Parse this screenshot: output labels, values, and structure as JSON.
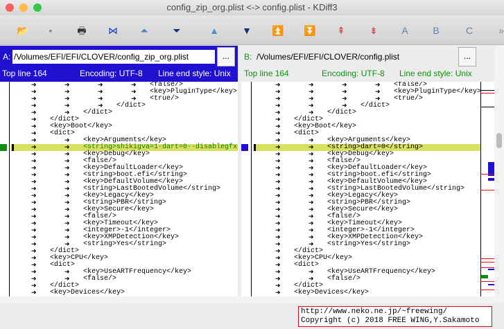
{
  "window": {
    "title": "config_zip_org.plist <-> config.plist - KDiff3"
  },
  "toolbar": [
    "open-icon",
    "save-icon",
    "print-icon",
    "goto-current-delta-icon",
    "goto-first-delta-icon",
    "goto-last-delta-icon",
    "goto-prev-delta-icon",
    "goto-next-delta-icon",
    "goto-prev-conflict-icon",
    "goto-next-conflict-icon",
    "goto-prev-unsolved-conflict-icon",
    "goto-next-unsolved-conflict-icon",
    "select-a-icon",
    "select-b-icon",
    "select-c-icon",
    "more-icon"
  ],
  "toolbar_glyphs": [
    "📂",
    "▪",
    "🖶",
    "⋈",
    "⏶",
    "⏷",
    "▲",
    "▼",
    "⏫",
    "⏬",
    "⇞",
    "⇟",
    "A",
    "B",
    "C",
    "»"
  ],
  "paneA": {
    "label": "A:",
    "path": "/Volumes/EFI/EFI/CLOVER/config_zip_org.plist",
    "browse": "...",
    "top_line": "Top line 164",
    "encoding": "Encoding: UTF-8",
    "line_end": "Line end style: Unix",
    "color": "#2010d0"
  },
  "paneB": {
    "label": "B:",
    "path": "/Volumes/EFI/EFI/CLOVER/config.plist",
    "browse": "...",
    "top_line": "Top line 164",
    "encoding": "Encoding: UTF-8",
    "line_end": "Line end style: Unix",
    "color": "#109010"
  },
  "linesA": [
    [
      4,
      "<false/>"
    ],
    [
      4,
      "<key>PluginType</key>"
    ],
    [
      4,
      "<true/>"
    ],
    [
      3,
      "</dict>"
    ],
    [
      2,
      "</dict>"
    ],
    [
      1,
      "</dict>"
    ],
    [
      1,
      "<key>Boot</key>"
    ],
    [
      1,
      "<dict>"
    ],
    [
      2,
      "<key>Arguments</key>"
    ],
    [
      2,
      "<string>shikigva=1·dart=0·-disablegfx",
      true
    ],
    [
      2,
      "<key>Debug</key>"
    ],
    [
      2,
      "<false/>"
    ],
    [
      2,
      "<key>DefaultLoader</key>"
    ],
    [
      2,
      "<string>boot.efi</string>"
    ],
    [
      2,
      "<key>DefaultVolume</key>"
    ],
    [
      2,
      "<string>LastBootedVolume</string>"
    ],
    [
      2,
      "<key>Legacy</key>"
    ],
    [
      2,
      "<string>PBR</string>"
    ],
    [
      2,
      "<key>Secure</key>"
    ],
    [
      2,
      "<false/>"
    ],
    [
      2,
      "<key>Timeout</key>"
    ],
    [
      2,
      "<integer>-1</integer>"
    ],
    [
      2,
      "<key>XMPDetection</key>"
    ],
    [
      2,
      "<string>Yes</string>"
    ],
    [
      1,
      "</dict>"
    ],
    [
      1,
      "<key>CPU</key>"
    ],
    [
      1,
      "<dict>"
    ],
    [
      2,
      "<key>UseARTFrequency</key>"
    ],
    [
      2,
      "<false/>"
    ],
    [
      1,
      "</dict>"
    ],
    [
      1,
      "<key>Devices</key>"
    ]
  ],
  "linesB": [
    [
      4,
      "<false/>"
    ],
    [
      4,
      "<key>PluginType</key>"
    ],
    [
      4,
      "<true/>"
    ],
    [
      3,
      "</dict>"
    ],
    [
      2,
      "</dict>"
    ],
    [
      1,
      "</dict>"
    ],
    [
      1,
      "<key>Boot</key>"
    ],
    [
      1,
      "<dict>"
    ],
    [
      2,
      "<key>Arguments</key>"
    ],
    [
      2,
      "<string>dart=0</string>",
      true
    ],
    [
      2,
      "<key>Debug</key>"
    ],
    [
      2,
      "<false/>"
    ],
    [
      2,
      "<key>DefaultLoader</key>"
    ],
    [
      2,
      "<string>boot.efi</string>"
    ],
    [
      2,
      "<key>DefaultVolume</key>"
    ],
    [
      2,
      "<string>LastBootedVolume</string>"
    ],
    [
      2,
      "<key>Legacy</key>"
    ],
    [
      2,
      "<string>PBR</string>"
    ],
    [
      2,
      "<key>Secure</key>"
    ],
    [
      2,
      "<false/>"
    ],
    [
      2,
      "<key>Timeout</key>"
    ],
    [
      2,
      "<integer>-1</integer>"
    ],
    [
      2,
      "<key>XMPDetection</key>"
    ],
    [
      2,
      "<string>Yes</string>"
    ],
    [
      1,
      "</dict>"
    ],
    [
      1,
      "<key>CPU</key>"
    ],
    [
      1,
      "<dict>"
    ],
    [
      2,
      "<key>UseARTFrequency</key>"
    ],
    [
      2,
      "<false/>"
    ],
    [
      1,
      "</dict>"
    ],
    [
      1,
      "<key>Devices</key>"
    ]
  ],
  "credit": {
    "line1": "http://www.neko.ne.jp/~freewing/",
    "line2": "Copyright (c) 2018 FREE WING,Y.Sakamoto"
  }
}
